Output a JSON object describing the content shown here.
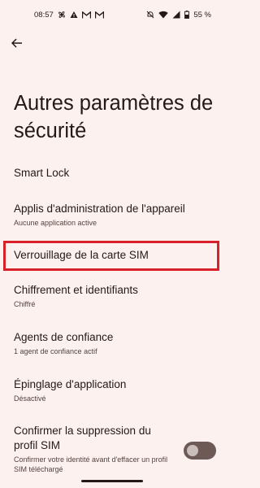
{
  "status_bar": {
    "time": "08:57",
    "battery": "55 %",
    "left_icons": [
      "fan-icon",
      "warning-icon",
      "gmail-icon",
      "gmail-icon"
    ],
    "right_icons": [
      "do-not-disturb-icon",
      "wifi-icon",
      "signal-icon",
      "battery-icon"
    ]
  },
  "header": {
    "title": "Autres paramètres de sécurité"
  },
  "items": [
    {
      "title": "Smart Lock",
      "subtitle": ""
    },
    {
      "title": "Applis d'administration de l'appareil",
      "subtitle": "Aucune application active"
    },
    {
      "title": "Verrouillage de la carte SIM",
      "subtitle": ""
    },
    {
      "title": "Chiffrement et identifiants",
      "subtitle": "Chiffré"
    },
    {
      "title": "Agents de confiance",
      "subtitle": "1 agent de confiance actif"
    },
    {
      "title": "Épinglage d'application",
      "subtitle": "Désactivé"
    },
    {
      "title": "Confirmer la suppression du profil SIM",
      "subtitle": "Confirmer votre identité avant d'effacer un profil SIM téléchargé"
    }
  ],
  "toggle_confirm_sim_deletion": {
    "on": false
  },
  "colors": {
    "background": "#fcf1ef",
    "highlight": "#d8202a",
    "text": "#231917",
    "subtext": "#55433f"
  }
}
